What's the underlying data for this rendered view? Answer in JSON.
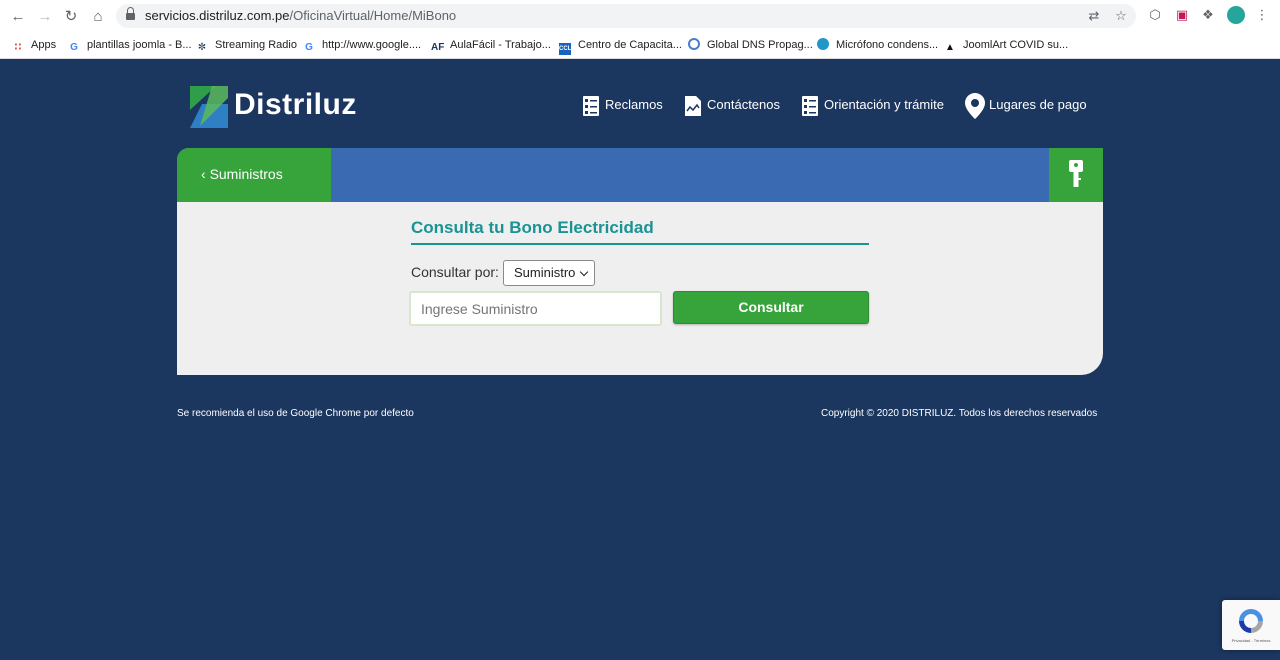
{
  "browser": {
    "url_domain": "servicios.distriluz.com.pe",
    "url_path": "/OficinaVirtual/Home/MiBono",
    "nav_icons": [
      "back-arrow-icon",
      "forward-arrow-icon",
      "reload-icon",
      "home-icon"
    ],
    "bookmarks": [
      {
        "label": "Apps",
        "icon": "apps-grid-icon"
      },
      {
        "label": "plantillas joomla - B...",
        "icon": "google-icon"
      },
      {
        "label": "Streaming Radio",
        "icon": "radio-icon"
      },
      {
        "label": "http://www.google....",
        "icon": "google-icon"
      },
      {
        "label": "AulaFácil - Trabajo...",
        "icon": "aulafacil-icon"
      },
      {
        "label": "Centro de Capacita...",
        "icon": "ccl-icon"
      },
      {
        "label": "Global DNS Propag...",
        "icon": "dns-icon"
      },
      {
        "label": "Micrófono condens...",
        "icon": "circle-icon"
      },
      {
        "label": "JoomlArt COVID su...",
        "icon": "joomlart-icon"
      }
    ]
  },
  "header": {
    "brand": "Distriluz",
    "menu": [
      {
        "label": "Reclamos",
        "icon": "checklist-icon"
      },
      {
        "label": "Contáctenos",
        "icon": "document-icon"
      },
      {
        "label": "Orientación y trámite",
        "icon": "checklist-icon"
      },
      {
        "label": "Lugares de pago",
        "icon": "map-pin-icon"
      }
    ]
  },
  "card": {
    "back_label": "Suministros",
    "title": "Consulta tu Bono Electricidad",
    "consult_label": "Consultar por:",
    "select_value": "Suministro",
    "input_placeholder": "Ingrese Suministro",
    "submit_label": "Consultar"
  },
  "footer": {
    "left": "Se recomienda el uso de Google Chrome por defecto",
    "right": "Copyright © 2020 DISTRILUZ. Todos los derechos reservados"
  },
  "recaptcha": {
    "text": "Privacidad - Términos"
  },
  "colors": {
    "page_bg": "#1b365f",
    "brand_green": "#37a33b",
    "bar_blue": "#3a6ab1",
    "title_teal": "#1a9394"
  }
}
